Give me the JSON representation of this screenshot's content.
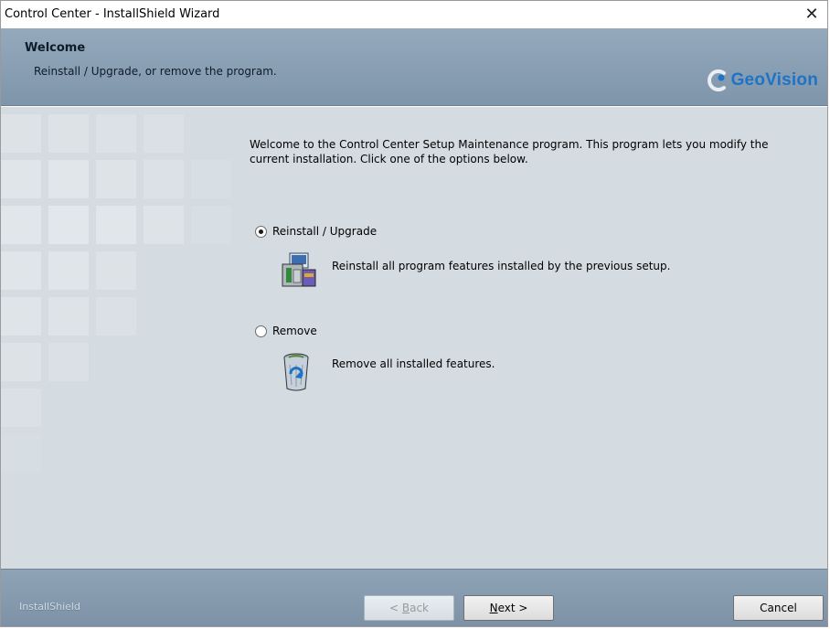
{
  "window": {
    "title": "Control Center - InstallShield Wizard",
    "close_glyph": "✕"
  },
  "header": {
    "title": "Welcome",
    "subtitle": "Reinstall / Upgrade, or remove the program.",
    "logo_text": "GeoVision",
    "logo_color": "#1e73c7"
  },
  "body": {
    "intro": "Welcome to the Control Center Setup Maintenance program. This program lets you modify the current installation. Click one of the options below.",
    "options": [
      {
        "label": "Reinstall / Upgrade",
        "description": "Reinstall all program features installed by the previous setup.",
        "selected": true,
        "icon": "reinstall-setup-icon"
      },
      {
        "label": "Remove",
        "description": "Remove all installed features.",
        "selected": false,
        "icon": "recycle-bin-icon"
      }
    ]
  },
  "footer": {
    "brand": "InstallShield",
    "back_prefix": "< ",
    "back_mnemonic": "B",
    "back_rest": "ack",
    "next_mnemonic": "N",
    "next_rest": "ext >",
    "cancel_label": "Cancel",
    "back_enabled": false
  },
  "colors": {
    "header_bg": "#94a9bc",
    "body_bg": "#d4dbe1",
    "footer_bg": "#8ea3b6"
  }
}
